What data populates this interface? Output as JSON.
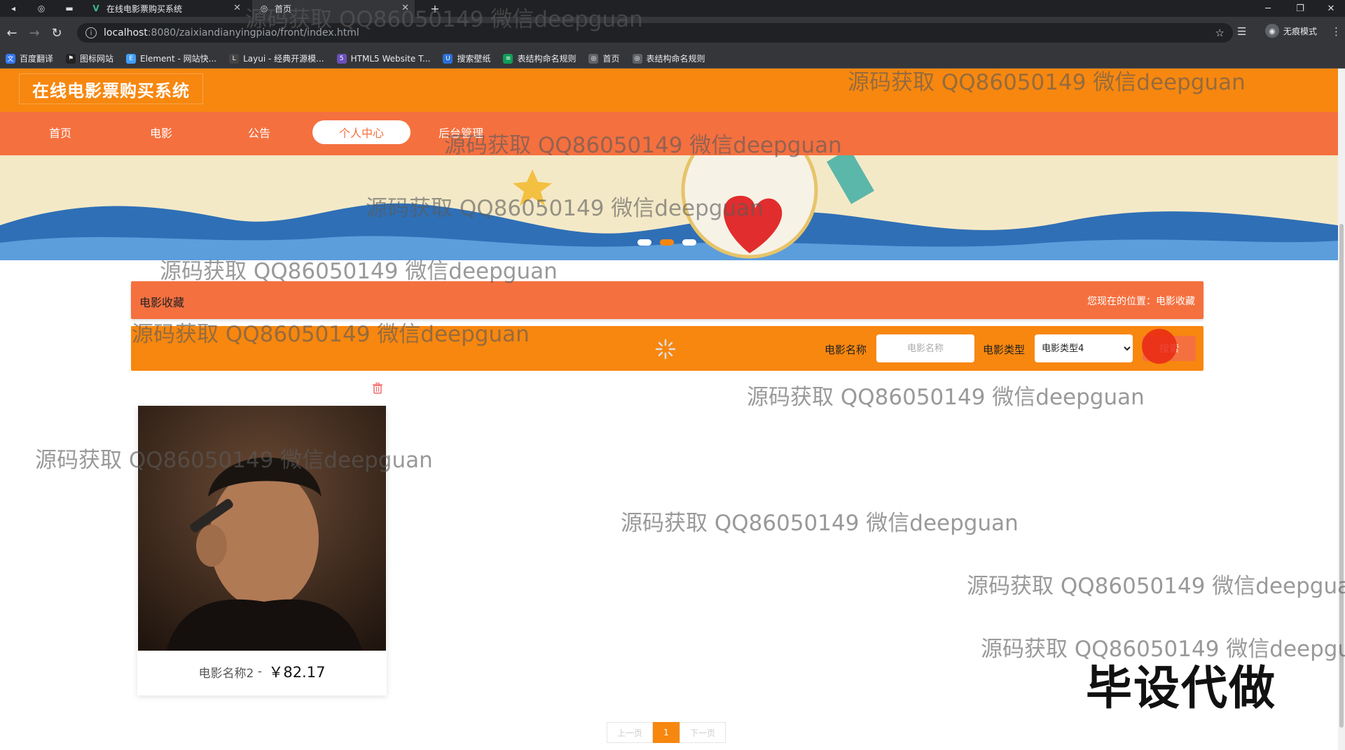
{
  "browser": {
    "tabs": [
      {
        "title": "在线电影票购买系统",
        "active": false
      },
      {
        "title": "首页",
        "active": true
      }
    ],
    "url_host": "localhost",
    "url_path": ":8080/zaixiandianyingpiao/front/index.html",
    "profile_label": "无痕模式",
    "bookmarks": [
      "百度翻译",
      "图标网站",
      "Element - 网站快...",
      "Layui - 经典开源模...",
      "HTML5 Website T...",
      "搜索壁纸",
      "表结构命名规则",
      "首页",
      "表结构命名规则"
    ]
  },
  "site": {
    "brand": "在线电影票购买系统",
    "nav": [
      "首页",
      "电影",
      "公告",
      "个人中心",
      "后台管理"
    ],
    "active_nav_index": 3
  },
  "section": {
    "title": "电影收藏",
    "location_label": "您现在的位置：电影收藏"
  },
  "search": {
    "name_label": "电影名称",
    "name_placeholder": "电影名称",
    "type_label": "电影类型",
    "type_selected": "电影类型4",
    "button_label": "搜索"
  },
  "items": [
    {
      "name": "电影名称2",
      "separator": " - ",
      "price": "￥82.17"
    }
  ],
  "pagination": {
    "prev": "上一页",
    "current": "1",
    "next": "下一页"
  },
  "overlay": {
    "watermark": "源码获取 QQ86050149 微信deepguan",
    "stamp": "毕设代做"
  },
  "colors": {
    "header": "#f7870f",
    "nav": "#f5703f",
    "accent": "#f5703f"
  }
}
